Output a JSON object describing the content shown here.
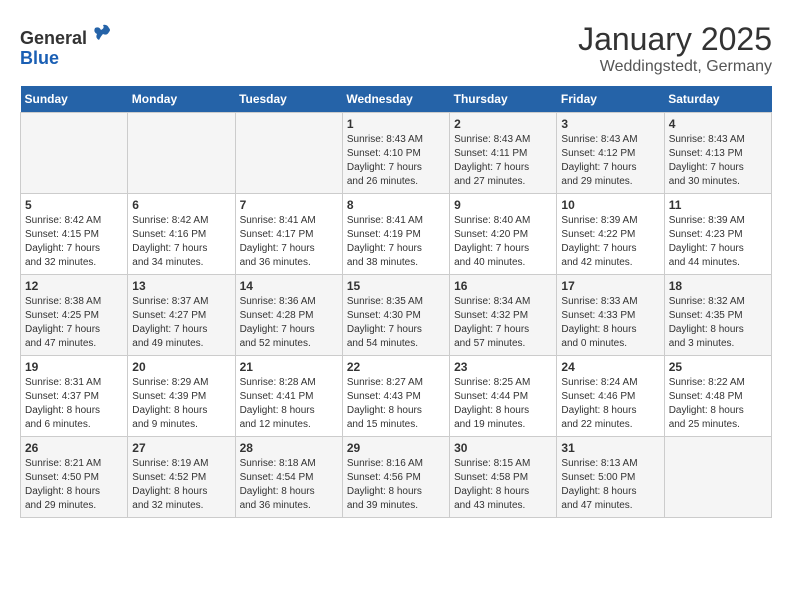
{
  "header": {
    "logo_general": "General",
    "logo_blue": "Blue",
    "month": "January 2025",
    "location": "Weddingstedt, Germany"
  },
  "weekdays": [
    "Sunday",
    "Monday",
    "Tuesday",
    "Wednesday",
    "Thursday",
    "Friday",
    "Saturday"
  ],
  "weeks": [
    [
      {
        "day": "",
        "info": ""
      },
      {
        "day": "",
        "info": ""
      },
      {
        "day": "",
        "info": ""
      },
      {
        "day": "1",
        "info": "Sunrise: 8:43 AM\nSunset: 4:10 PM\nDaylight: 7 hours\nand 26 minutes."
      },
      {
        "day": "2",
        "info": "Sunrise: 8:43 AM\nSunset: 4:11 PM\nDaylight: 7 hours\nand 27 minutes."
      },
      {
        "day": "3",
        "info": "Sunrise: 8:43 AM\nSunset: 4:12 PM\nDaylight: 7 hours\nand 29 minutes."
      },
      {
        "day": "4",
        "info": "Sunrise: 8:43 AM\nSunset: 4:13 PM\nDaylight: 7 hours\nand 30 minutes."
      }
    ],
    [
      {
        "day": "5",
        "info": "Sunrise: 8:42 AM\nSunset: 4:15 PM\nDaylight: 7 hours\nand 32 minutes."
      },
      {
        "day": "6",
        "info": "Sunrise: 8:42 AM\nSunset: 4:16 PM\nDaylight: 7 hours\nand 34 minutes."
      },
      {
        "day": "7",
        "info": "Sunrise: 8:41 AM\nSunset: 4:17 PM\nDaylight: 7 hours\nand 36 minutes."
      },
      {
        "day": "8",
        "info": "Sunrise: 8:41 AM\nSunset: 4:19 PM\nDaylight: 7 hours\nand 38 minutes."
      },
      {
        "day": "9",
        "info": "Sunrise: 8:40 AM\nSunset: 4:20 PM\nDaylight: 7 hours\nand 40 minutes."
      },
      {
        "day": "10",
        "info": "Sunrise: 8:39 AM\nSunset: 4:22 PM\nDaylight: 7 hours\nand 42 minutes."
      },
      {
        "day": "11",
        "info": "Sunrise: 8:39 AM\nSunset: 4:23 PM\nDaylight: 7 hours\nand 44 minutes."
      }
    ],
    [
      {
        "day": "12",
        "info": "Sunrise: 8:38 AM\nSunset: 4:25 PM\nDaylight: 7 hours\nand 47 minutes."
      },
      {
        "day": "13",
        "info": "Sunrise: 8:37 AM\nSunset: 4:27 PM\nDaylight: 7 hours\nand 49 minutes."
      },
      {
        "day": "14",
        "info": "Sunrise: 8:36 AM\nSunset: 4:28 PM\nDaylight: 7 hours\nand 52 minutes."
      },
      {
        "day": "15",
        "info": "Sunrise: 8:35 AM\nSunset: 4:30 PM\nDaylight: 7 hours\nand 54 minutes."
      },
      {
        "day": "16",
        "info": "Sunrise: 8:34 AM\nSunset: 4:32 PM\nDaylight: 7 hours\nand 57 minutes."
      },
      {
        "day": "17",
        "info": "Sunrise: 8:33 AM\nSunset: 4:33 PM\nDaylight: 8 hours\nand 0 minutes."
      },
      {
        "day": "18",
        "info": "Sunrise: 8:32 AM\nSunset: 4:35 PM\nDaylight: 8 hours\nand 3 minutes."
      }
    ],
    [
      {
        "day": "19",
        "info": "Sunrise: 8:31 AM\nSunset: 4:37 PM\nDaylight: 8 hours\nand 6 minutes."
      },
      {
        "day": "20",
        "info": "Sunrise: 8:29 AM\nSunset: 4:39 PM\nDaylight: 8 hours\nand 9 minutes."
      },
      {
        "day": "21",
        "info": "Sunrise: 8:28 AM\nSunset: 4:41 PM\nDaylight: 8 hours\nand 12 minutes."
      },
      {
        "day": "22",
        "info": "Sunrise: 8:27 AM\nSunset: 4:43 PM\nDaylight: 8 hours\nand 15 minutes."
      },
      {
        "day": "23",
        "info": "Sunrise: 8:25 AM\nSunset: 4:44 PM\nDaylight: 8 hours\nand 19 minutes."
      },
      {
        "day": "24",
        "info": "Sunrise: 8:24 AM\nSunset: 4:46 PM\nDaylight: 8 hours\nand 22 minutes."
      },
      {
        "day": "25",
        "info": "Sunrise: 8:22 AM\nSunset: 4:48 PM\nDaylight: 8 hours\nand 25 minutes."
      }
    ],
    [
      {
        "day": "26",
        "info": "Sunrise: 8:21 AM\nSunset: 4:50 PM\nDaylight: 8 hours\nand 29 minutes."
      },
      {
        "day": "27",
        "info": "Sunrise: 8:19 AM\nSunset: 4:52 PM\nDaylight: 8 hours\nand 32 minutes."
      },
      {
        "day": "28",
        "info": "Sunrise: 8:18 AM\nSunset: 4:54 PM\nDaylight: 8 hours\nand 36 minutes."
      },
      {
        "day": "29",
        "info": "Sunrise: 8:16 AM\nSunset: 4:56 PM\nDaylight: 8 hours\nand 39 minutes."
      },
      {
        "day": "30",
        "info": "Sunrise: 8:15 AM\nSunset: 4:58 PM\nDaylight: 8 hours\nand 43 minutes."
      },
      {
        "day": "31",
        "info": "Sunrise: 8:13 AM\nSunset: 5:00 PM\nDaylight: 8 hours\nand 47 minutes."
      },
      {
        "day": "",
        "info": ""
      }
    ]
  ]
}
